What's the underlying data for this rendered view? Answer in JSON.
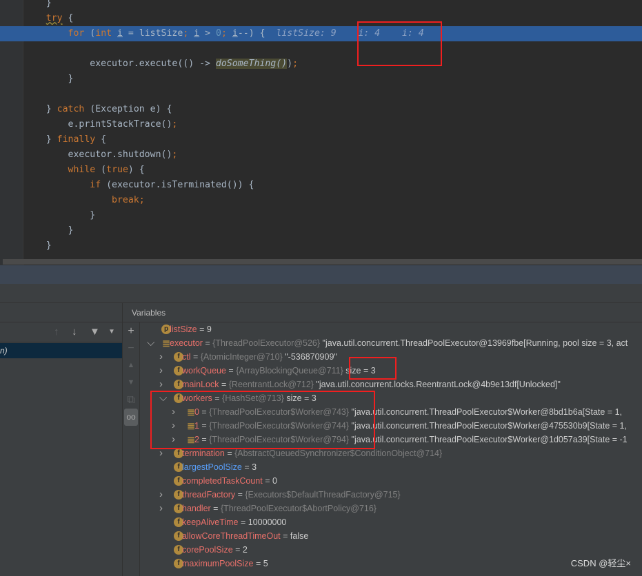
{
  "code": [
    {
      "indent": 2,
      "tokens": [
        [
          "",
          "}"
        ]
      ]
    },
    {
      "indent": 2,
      "tokens": [
        [
          "kw wavy",
          "try"
        ],
        [
          "",
          " {"
        ]
      ]
    },
    {
      "indent": 3,
      "highlight": true,
      "tokens": [
        [
          "kw",
          "for"
        ],
        [
          "",
          " ("
        ],
        [
          "kw",
          "int "
        ],
        [
          "ul",
          "i"
        ],
        [
          "",
          " = listSize"
        ],
        [
          "kw",
          ";"
        ],
        [
          "",
          " "
        ],
        [
          "ul",
          "i"
        ],
        [
          "",
          " > "
        ],
        [
          "num",
          "0"
        ],
        [
          "kw",
          ";"
        ],
        [
          "",
          " "
        ],
        [
          "ul",
          "i"
        ],
        [
          "",
          "--) {  "
        ],
        [
          "hint",
          "listSize: 9    i: 4    i: 4"
        ]
      ]
    },
    {
      "indent": 0,
      "tokens": []
    },
    {
      "indent": 4,
      "tokens": [
        [
          "",
          "executor.execute(() -> "
        ],
        [
          "fn",
          "doSomeThing"
        ],
        [
          "fn",
          "()"
        ],
        [
          "",
          ")"
        ],
        [
          "kw",
          ";"
        ]
      ]
    },
    {
      "indent": 3,
      "tokens": [
        [
          "",
          "}"
        ]
      ]
    },
    {
      "indent": 0,
      "tokens": []
    },
    {
      "indent": 2,
      "tokens": [
        [
          "",
          "} "
        ],
        [
          "kw",
          "catch"
        ],
        [
          "",
          " (Exception e) {"
        ]
      ]
    },
    {
      "indent": 3,
      "tokens": [
        [
          "",
          "e.printStackTrace()"
        ],
        [
          "kw",
          ";"
        ]
      ]
    },
    {
      "indent": 2,
      "tokens": [
        [
          "",
          "} "
        ],
        [
          "kw",
          "finally"
        ],
        [
          "",
          " {"
        ]
      ]
    },
    {
      "indent": 3,
      "tokens": [
        [
          "",
          "executor.shutdown()"
        ],
        [
          "kw",
          ";"
        ]
      ]
    },
    {
      "indent": 3,
      "tokens": [
        [
          "kw",
          "while"
        ],
        [
          "",
          " ("
        ],
        [
          "kw",
          "true"
        ],
        [
          "",
          ") {"
        ]
      ]
    },
    {
      "indent": 4,
      "tokens": [
        [
          "kw",
          "if"
        ],
        [
          "",
          " (executor.isTerminated()) {"
        ]
      ]
    },
    {
      "indent": 5,
      "tokens": [
        [
          "kw",
          "break;"
        ]
      ]
    },
    {
      "indent": 4,
      "tokens": [
        [
          "",
          "}"
        ]
      ]
    },
    {
      "indent": 3,
      "tokens": [
        [
          "",
          "}"
        ]
      ]
    },
    {
      "indent": 2,
      "tokens": [
        [
          "",
          "}"
        ]
      ]
    }
  ],
  "frames": {
    "selected_text": "n)"
  },
  "variables_panel": {
    "title": "Variables"
  },
  "side_toolbar": [
    "plus-icon",
    "minus-icon",
    "up-icon",
    "down-icon",
    "copy-icon",
    "watches-icon"
  ],
  "variables": [
    {
      "depth": 0,
      "expand": "none",
      "icon": "p",
      "name": "listSize",
      "sep": " = ",
      "type": "",
      "value": "9"
    },
    {
      "depth": 0,
      "expand": "open",
      "icon": "list",
      "name": "executor",
      "sep": " = ",
      "type": "{ThreadPoolExecutor@526}",
      "value": " \"java.util.concurrent.ThreadPoolExecutor@13969fbe[Running, pool size = 3, act"
    },
    {
      "depth": 1,
      "expand": "closed",
      "icon": "f",
      "name": "ctl",
      "sep": " = ",
      "type": "{AtomicInteger@710}",
      "value": " \"-536870909\""
    },
    {
      "depth": 1,
      "expand": "closed",
      "icon": "f",
      "name": "workQueue",
      "sep": " = ",
      "type": "{ArrayBlockingQueue@711}",
      "value": "  size = 3"
    },
    {
      "depth": 1,
      "expand": "closed",
      "icon": "f",
      "name": "mainLock",
      "sep": " = ",
      "type": "{ReentrantLock@712}",
      "value": " \"java.util.concurrent.locks.ReentrantLock@4b9e13df[Unlocked]\""
    },
    {
      "depth": 1,
      "expand": "open",
      "icon": "f",
      "name": "workers",
      "sep": " = ",
      "type": "{HashSet@713}",
      "value": "  size = 3"
    },
    {
      "depth": 2,
      "expand": "closed",
      "icon": "list",
      "name": "0",
      "sep": " = ",
      "type": "{ThreadPoolExecutor$Worker@743}",
      "value": " \"java.util.concurrent.ThreadPoolExecutor$Worker@8bd1b6a[State = 1, "
    },
    {
      "depth": 2,
      "expand": "closed",
      "icon": "list",
      "name": "1",
      "sep": " = ",
      "type": "{ThreadPoolExecutor$Worker@744}",
      "value": " \"java.util.concurrent.ThreadPoolExecutor$Worker@475530b9[State = 1,"
    },
    {
      "depth": 2,
      "expand": "closed",
      "icon": "list",
      "name": "2",
      "sep": " = ",
      "type": "{ThreadPoolExecutor$Worker@794}",
      "value": " \"java.util.concurrent.ThreadPoolExecutor$Worker@1d057a39[State = -1"
    },
    {
      "depth": 1,
      "expand": "closed",
      "icon": "f",
      "name": "termination",
      "sep": " = ",
      "type": "{AbstractQueuedSynchronizer$ConditionObject@714}",
      "value": ""
    },
    {
      "depth": 1,
      "expand": "none",
      "icon": "f",
      "name": "largestPoolSize",
      "blue": true,
      "sep": " = ",
      "type": "",
      "value": "3"
    },
    {
      "depth": 1,
      "expand": "none",
      "icon": "f",
      "name": "completedTaskCount",
      "sep": " = ",
      "type": "",
      "value": "0"
    },
    {
      "depth": 1,
      "expand": "closed",
      "icon": "f",
      "name": "threadFactory",
      "sep": " = ",
      "type": "{Executors$DefaultThreadFactory@715}",
      "value": ""
    },
    {
      "depth": 1,
      "expand": "closed",
      "icon": "f",
      "name": "handler",
      "sep": " = ",
      "type": "{ThreadPoolExecutor$AbortPolicy@716}",
      "value": ""
    },
    {
      "depth": 1,
      "expand": "none",
      "icon": "f",
      "name": "keepAliveTime",
      "sep": " = ",
      "type": "",
      "value": "10000000"
    },
    {
      "depth": 1,
      "expand": "none",
      "icon": "f",
      "name": "allowCoreThreadTimeOut",
      "sep": " = ",
      "type": "",
      "value": "false"
    },
    {
      "depth": 1,
      "expand": "none",
      "icon": "f",
      "name": "corePoolSize",
      "sep": " = ",
      "type": "",
      "value": "2"
    },
    {
      "depth": 1,
      "expand": "none",
      "icon": "f",
      "name": "maximumPoolSize",
      "sep": " = ",
      "type": "",
      "value": "5"
    }
  ],
  "watermark": "CSDN @轻尘×",
  "colors": {
    "highlight_line": "#2d5c9a",
    "annotation_box": "#f01f1f",
    "field_name": "#e8706a"
  }
}
